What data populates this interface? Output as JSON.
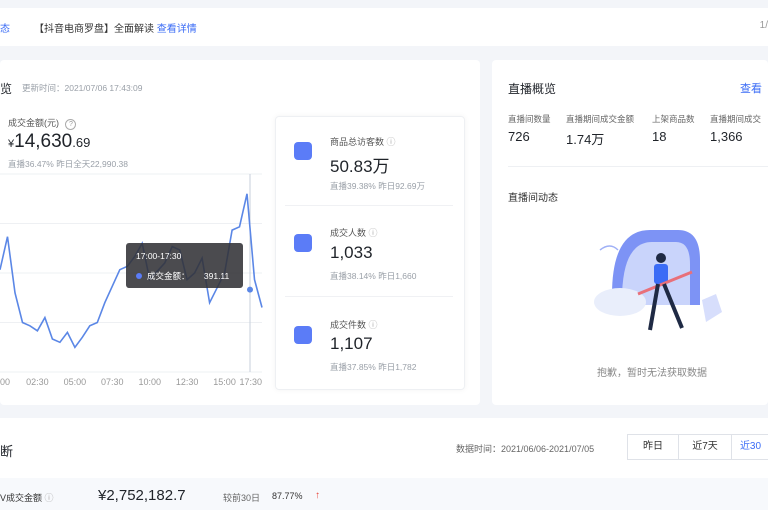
{
  "topbar": {
    "left_fragment": "态",
    "notice_prefix": "【抖音电商罗盘】全面解读",
    "notice_link": "查看详情",
    "right_fragment": "1/"
  },
  "overview": {
    "title": "览",
    "updated_label": "更新时间：2021/07/06 17:43:09",
    "gmv_label": "成交金额(元)",
    "gmv_currency": "¥",
    "gmv_int": "14,630",
    "gmv_dec": ".69",
    "gmv_compare": "直播36.47%  昨日全天22,990.38",
    "stats": [
      {
        "label": "商品总访客数",
        "value": "50.83万",
        "compare": "直播39.38%  昨日92.69万"
      },
      {
        "label": "成交人数",
        "value": "1,033",
        "compare": "直播38.14%  昨日1,660"
      },
      {
        "label": "成交件数",
        "value": "1,107",
        "compare": "直播37.85%  昨日1,782"
      }
    ],
    "tooltip": {
      "time": "17:00-17:30",
      "label": "成交金额：",
      "value": "391.11"
    }
  },
  "chart_data": {
    "type": "line",
    "x": [
      "00:00",
      "00:30",
      "01:00",
      "01:30",
      "02:00",
      "02:30",
      "03:00",
      "03:30",
      "04:00",
      "04:30",
      "05:00",
      "05:30",
      "06:00",
      "06:30",
      "07:00",
      "07:30",
      "08:00",
      "08:30",
      "09:00",
      "09:30",
      "10:00",
      "10:30",
      "11:00",
      "11:30",
      "12:00",
      "12:30",
      "13:00",
      "13:30",
      "14:00",
      "14:30",
      "15:00",
      "15:30",
      "16:00",
      "16:30",
      "17:00",
      "17:30"
    ],
    "values": [
      620,
      820,
      480,
      300,
      280,
      250,
      330,
      200,
      180,
      240,
      150,
      210,
      280,
      300,
      420,
      520,
      620,
      640,
      700,
      780,
      560,
      610,
      660,
      760,
      740,
      560,
      600,
      690,
      420,
      510,
      600,
      860,
      880,
      1080,
      560,
      391
    ],
    "xticks": [
      "00",
      "02:30",
      "05:00",
      "07:30",
      "10:00",
      "12:30",
      "15:00",
      "17:30"
    ],
    "xtick_index": [
      0,
      5,
      10,
      15,
      20,
      25,
      30,
      35
    ],
    "ylim": [
      0,
      1200
    ],
    "grid": true,
    "series_color": "#5b87e6"
  },
  "live": {
    "title": "直播概览",
    "view_link": "查看",
    "metrics": [
      {
        "label": "直播间数量",
        "value": "726"
      },
      {
        "label": "直播期间成交金额",
        "value": "1.74万"
      },
      {
        "label": "上架商品数",
        "value": "18"
      },
      {
        "label": "直播期间成交",
        "value": "1,366"
      }
    ],
    "feed_title": "直播间动态",
    "empty_text": "抱歉，暂时无法获取数据"
  },
  "diagnosis": {
    "title": "断",
    "data_time": "数据时间：2021/06/06-2021/07/05",
    "buttons": [
      "昨日",
      "近7天",
      "近30"
    ],
    "gmv_label": "V成交金额",
    "gmv_value": "¥2,752,182.7",
    "compare_label": "较前30日",
    "compare_value": "87.77%",
    "trend_arrow": "↑"
  },
  "colors": {
    "accent": "#3b6cf6",
    "up": "#e8443a"
  }
}
